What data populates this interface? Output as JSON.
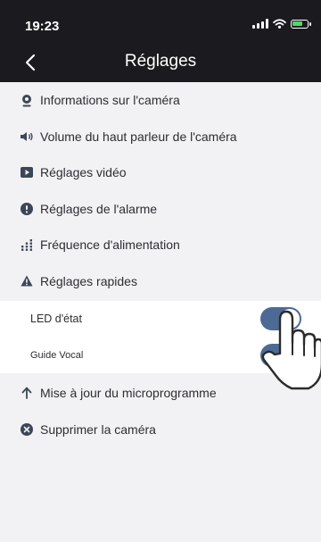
{
  "status": {
    "time": "19:23"
  },
  "nav": {
    "title": "Réglages"
  },
  "menu": [
    {
      "label": "Informations sur l'caméra",
      "icon": "camera-icon"
    },
    {
      "label": "Volume du haut parleur de l'caméra",
      "icon": "speaker-icon"
    },
    {
      "label": "Réglages vidéo",
      "icon": "video-icon"
    },
    {
      "label": "Réglages de l'alarme",
      "icon": "alarm-icon"
    },
    {
      "label": "Fréquence d'alimentation",
      "icon": "frequency-icon"
    },
    {
      "label": "Réglages rapides",
      "icon": "warning-icon"
    }
  ],
  "quick_settings": [
    {
      "label": "LED d'état",
      "enabled": true
    },
    {
      "label": "Guide Vocal",
      "enabled": true
    }
  ],
  "menu_bottom": [
    {
      "label": "Mise à jour du microprogramme",
      "icon": "arrow-up-icon"
    },
    {
      "label": "Supprimer la caméra",
      "icon": "delete-icon"
    }
  ],
  "colors": {
    "header": "#1b1b1f",
    "background": "#f2f2f4",
    "toggle_on": "#4d6a96",
    "icon": "#3c4659"
  }
}
